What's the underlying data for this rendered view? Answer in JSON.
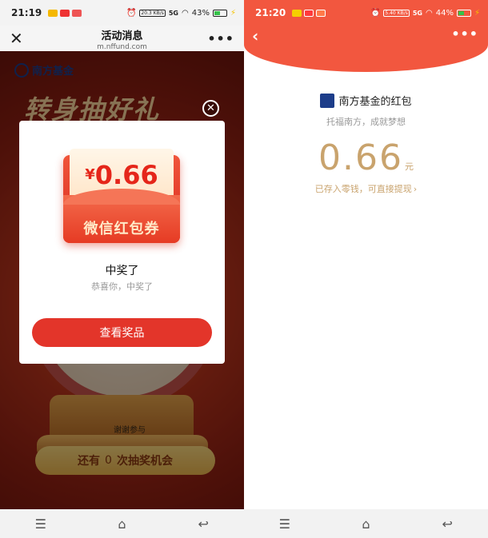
{
  "left": {
    "status": {
      "time": "21:19",
      "net": "20.3\nKB/s",
      "network": "5G",
      "battery": "43%"
    },
    "nav": {
      "title": "活动消息",
      "url": "m.nffund.com",
      "close": "✕",
      "more": "•••"
    },
    "page": {
      "logo": "南方基金",
      "deco_title": "转身抽好礼",
      "wheel_label": "谢谢参与",
      "chance_prefix": "还有",
      "chance_count": "0",
      "chance_suffix": "次抽奖机会"
    },
    "modal": {
      "close": "✕",
      "currency": "¥",
      "envelope_amount": "0.66",
      "envelope_label": "微信红包券",
      "title": "中奖了",
      "subtitle": "恭喜你，中奖了",
      "button": "查看奖品"
    }
  },
  "right": {
    "status": {
      "time": "21:20",
      "net": "5.40\nKB/s",
      "network": "5G",
      "battery": "44%"
    },
    "header": {
      "back": "‹",
      "more": "•••"
    },
    "sender_name": "南方基金的红包",
    "wish": "托福南方，成就梦想",
    "amount": "0.66",
    "unit": "元",
    "stored": "已存入零钱，可直接提现",
    "stored_chevron": "›"
  },
  "sysnav": {
    "menu": "☰",
    "home": "⌂",
    "back": "↩"
  },
  "colors": {
    "red": "#e3352a",
    "header_red": "#f2573f",
    "gold": "#c9a36d"
  }
}
